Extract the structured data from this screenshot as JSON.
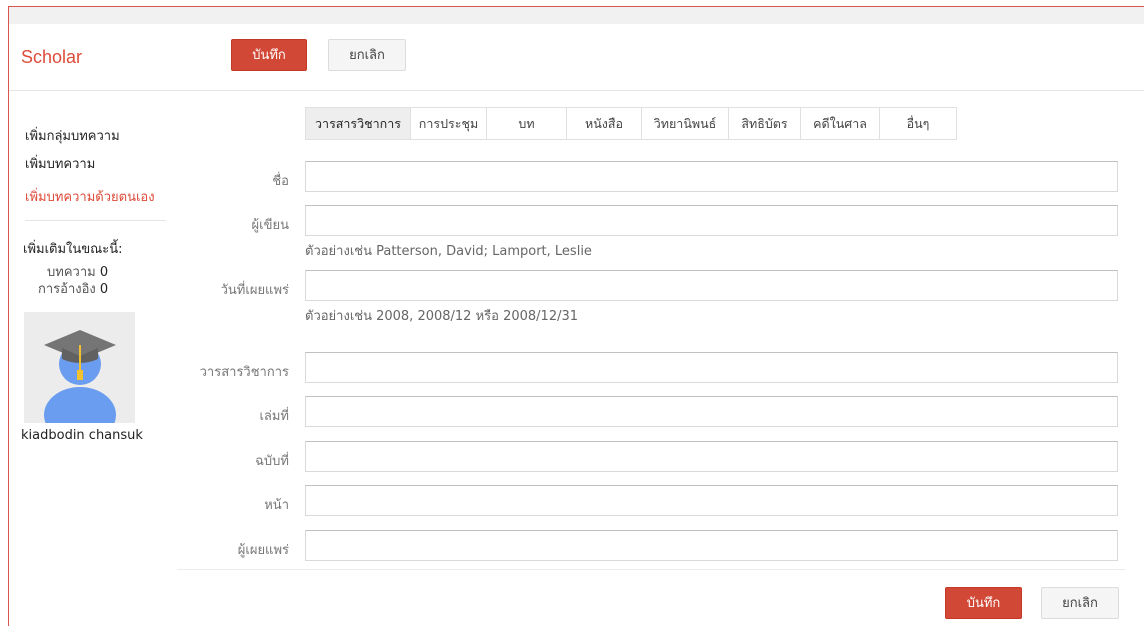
{
  "app": {
    "logo": "Scholar"
  },
  "header": {
    "save_label": "บันทึก",
    "cancel_label": "ยกเลิก"
  },
  "sidebar": {
    "links": [
      {
        "label": "เพิ่มกลุ่มบทความ"
      },
      {
        "label": "เพิ่มบทความ"
      },
      {
        "label": "เพิ่มบทความด้วยตนเอง"
      }
    ],
    "added_heading": "เพิ่มเติมในขณะนี้:",
    "stats": [
      {
        "label": "บทความ",
        "count": "0"
      },
      {
        "label": "การอ้างอิง",
        "count": "0"
      }
    ],
    "user_name": "kiadbodin chansuk"
  },
  "tabs": [
    {
      "label": "วารสารวิชาการ"
    },
    {
      "label": "การประชุม"
    },
    {
      "label": "บท"
    },
    {
      "label": "หนังสือ"
    },
    {
      "label": "วิทยานิพนธ์"
    },
    {
      "label": "สิทธิบัตร"
    },
    {
      "label": "คดีในศาล"
    },
    {
      "label": "อื่นๆ"
    }
  ],
  "form": {
    "fields": [
      {
        "label": "ชื่อ",
        "value": ""
      },
      {
        "label": "ผู้เขียน",
        "value": "",
        "hint": "ตัวอย่างเช่น Patterson, David; Lamport, Leslie"
      },
      {
        "label": "วันที่เผยแพร่",
        "value": "",
        "hint": "ตัวอย่างเช่น 2008, 2008/12 หรือ 2008/12/31"
      },
      {
        "label": "วารสารวิชาการ",
        "value": ""
      },
      {
        "label": "เล่มที่",
        "value": ""
      },
      {
        "label": "ฉบับที่",
        "value": ""
      },
      {
        "label": "หน้า",
        "value": ""
      },
      {
        "label": "ผู้เผยแพร่",
        "value": ""
      }
    ]
  },
  "footer": {
    "save_label": "บันทึก",
    "cancel_label": "ยกเลิก"
  },
  "colors": {
    "accent": "#dd4b39",
    "button_red": "#d14836"
  }
}
